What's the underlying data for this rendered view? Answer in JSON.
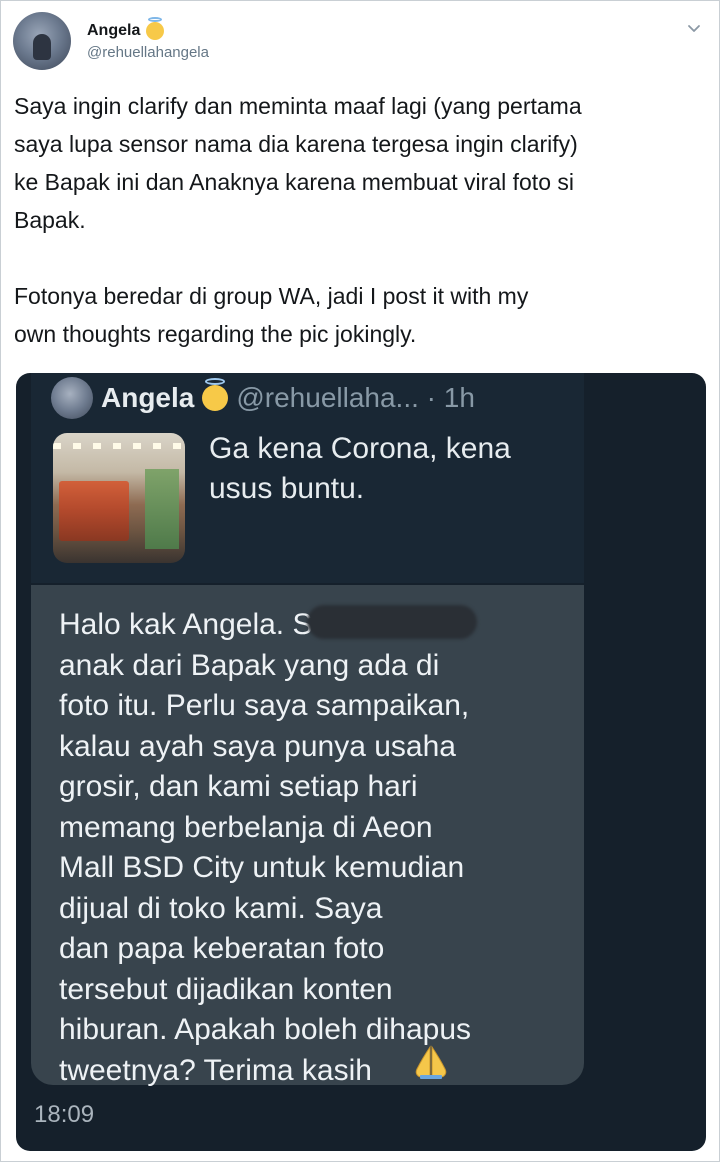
{
  "tweet": {
    "author_name": "Angela",
    "author_handle": "@rehuellahangela",
    "paragraphs": [
      "Saya ingin clarify dan meminta maaf lagi (yang pertama\nsaya lupa sensor nama dia karena tergesa ingin clarify)\nke Bapak ini dan Anaknya karena membuat viral foto si\nBapak.",
      "Fotonya beredar di group WA, jadi I post it with my\nown thoughts regarding the pic jokingly."
    ]
  },
  "media": {
    "quoted_tweet": {
      "name": "Angela",
      "handle_time": "@rehuellaha... · 1h",
      "text_lines": [
        "Ga kena Corona, kena",
        "usus buntu."
      ]
    },
    "reply_message": {
      "lines": [
        "Halo kak Angela. S",
        "anak dari Bapak yang ada di",
        "foto itu. Perlu saya sampaikan,",
        "kalau ayah saya punya usaha",
        "grosir, dan kami setiap hari",
        "memang berbelanja di Aeon",
        "Mall BSD City untuk kemudian",
        "dijual di toko kami. Saya",
        "dan papa keberatan foto",
        "tersebut dijadikan konten",
        "hiburan. Apakah boleh dihapus",
        "tweetnya? Terima kasih"
      ],
      "time": "18:09"
    }
  },
  "colors": {
    "dark_background": "#15202b",
    "bubble": "#38444d",
    "text_secondary": "#657786"
  },
  "icons": {
    "angel_emoji": "smiling-face-with-halo",
    "menu": "chevron-down",
    "pray_emoji": "folded-hands"
  }
}
